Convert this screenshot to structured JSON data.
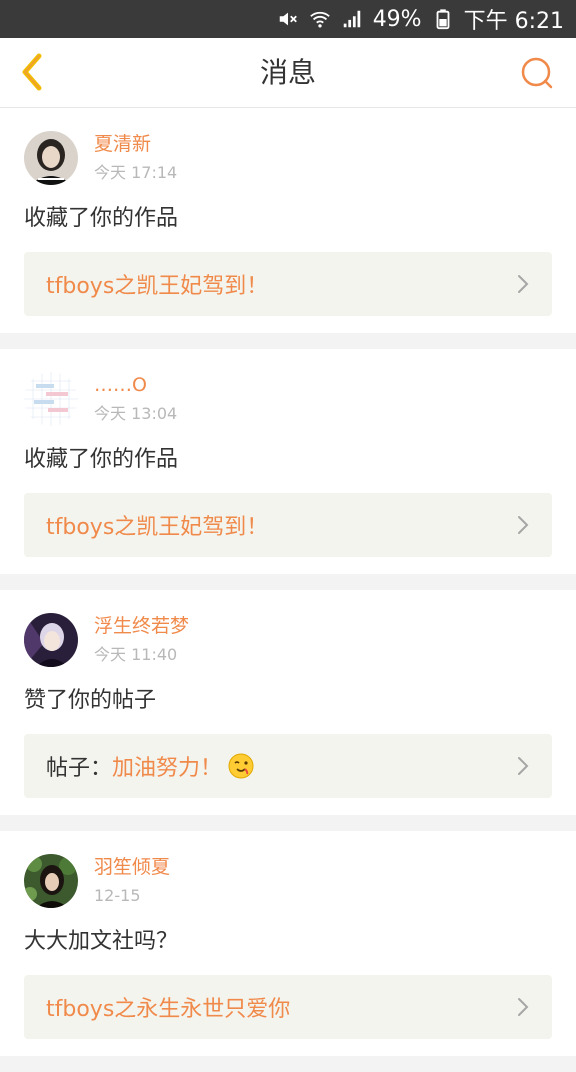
{
  "status_bar": {
    "battery": "49%",
    "time": "下午 6:21"
  },
  "header": {
    "title": "消息"
  },
  "colors": {
    "accent": "#f08a4b",
    "status_bar_bg": "#3a3a3a",
    "preview_bg": "#f4f4ee"
  },
  "messages": [
    {
      "user": "夏清新",
      "time": "今天 17:14",
      "action": "收藏了你的作品",
      "preview": "tfboys之凯王妃驾到！",
      "avatar": "avatar-photo-girl"
    },
    {
      "user": "……O",
      "time": "今天 13:04",
      "action": "收藏了你的作品",
      "preview": "tfboys之凯王妃驾到！",
      "avatar": "avatar-chat-screenshot"
    },
    {
      "user": "浮生终若梦",
      "time": "今天 11:40",
      "action": "赞了你的帖子",
      "preview_prefix": "帖子：",
      "preview": "加油努力！",
      "preview_emoji": "winking-face-icon",
      "avatar": "avatar-anime"
    },
    {
      "user": "羽笙倾夏",
      "time": "12-15",
      "action": "大大加文社吗？",
      "preview": "tfboys之永生永世只爱你",
      "avatar": "avatar-photo-leaves"
    }
  ]
}
